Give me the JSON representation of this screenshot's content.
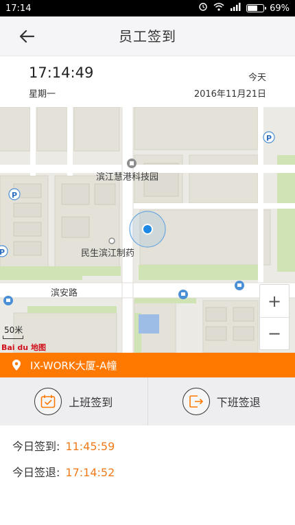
{
  "status_bar": {
    "time": "17:14",
    "battery": "69%",
    "battery_level": 0.69
  },
  "header": {
    "title": "员工签到",
    "back_icon": "arrow-left-icon"
  },
  "time_info": {
    "clock": "17:14:49",
    "weekday": "星期一",
    "today_label": "今天",
    "date": "2016年11月21日"
  },
  "map": {
    "labels": {
      "tech_park": "滨江慧港科技园",
      "pharma": "民生滨江制药",
      "road": "滨安路"
    },
    "scale": "50米",
    "logo": "Bai du 地图",
    "zoom_in": "+",
    "zoom_out": "−"
  },
  "location": {
    "text": "IX-WORK大厦-A幢"
  },
  "actions": {
    "check_in": "上班签到",
    "check_out": "下班签退"
  },
  "records": {
    "check_in_label": "今日签到:",
    "check_in_time": "11:45:59",
    "check_out_label": "今日签退:",
    "check_out_time": "17:14:52"
  },
  "colors": {
    "accent": "#ff7800",
    "time_value": "#f07a1a",
    "location_dot": "#1e88e5"
  }
}
